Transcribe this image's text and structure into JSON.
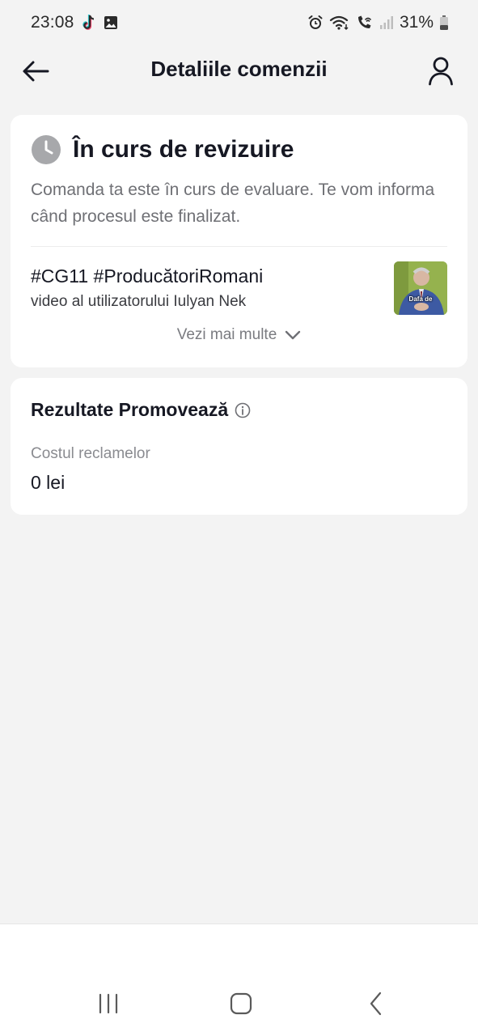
{
  "status_bar": {
    "time": "23:08",
    "battery": "31%",
    "left_icons": [
      "tiktok-icon",
      "gallery-icon"
    ],
    "right_icons": [
      "alarm-icon",
      "wifi-icon",
      "wifi-calling-icon",
      "signal-icon",
      "battery-icon"
    ]
  },
  "header": {
    "title": "Detaliile comenzii",
    "back_icon": "arrow-left-icon",
    "profile_icon": "user-icon"
  },
  "order_status": {
    "icon": "clock-icon",
    "title": "În curs de revizuire",
    "description": "Comanda ta este în curs de evaluare. Te vom informa când procesul este finalizat.",
    "video_title": "#CG11 #ProducătoriRomani",
    "video_subtitle": "video al utilizatorului Iulyan Nek",
    "thumbnail_caption": "Dafa de",
    "see_more": "Vezi mai multe"
  },
  "results": {
    "title": "Rezultate Promovează",
    "info_icon": "info-icon",
    "cost_label": "Costul reclamelor",
    "cost_value": "0 lei"
  },
  "nav_bar": {
    "buttons": [
      "recents-icon",
      "home-icon",
      "back-icon"
    ]
  },
  "colors": {
    "background": "#f3f3f3",
    "card": "#ffffff",
    "text_primary": "#161823",
    "text_secondary": "#6f7075",
    "clock_icon": "#a7a8ab"
  }
}
